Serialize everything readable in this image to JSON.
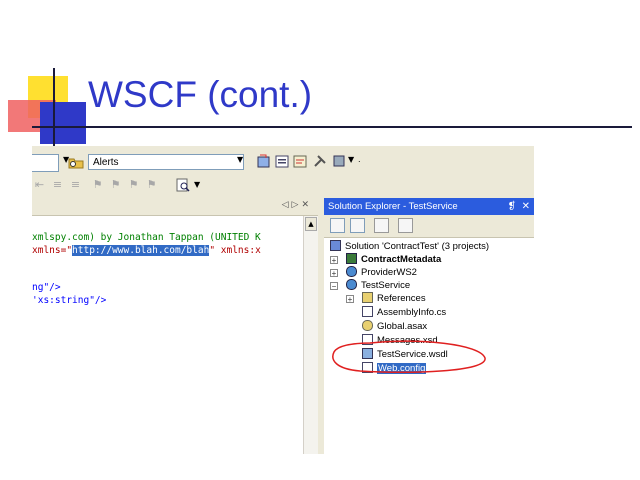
{
  "slide": {
    "title": "WSCF (cont.)"
  },
  "toolbar": {
    "combo_value": "Alerts"
  },
  "editor": {
    "line1_prefix": "xmlspy.com) by Jonathan Tappan (UNITED K",
    "line2_attr": "xmlns=\"",
    "line2_url": "http://www.blah.com/blah",
    "line2_tail": "\" xmlns:x",
    "line3": "ng\"/>",
    "line4": "'xs:string\"/>"
  },
  "solution_explorer": {
    "title": "Solution Explorer - TestService",
    "pin_glyph": "❡",
    "close_glyph": "✕",
    "items": [
      {
        "label": "Solution 'ContractTest' (3 projects)"
      },
      {
        "label": "ContractMetadata"
      },
      {
        "label": "ProviderWS2"
      },
      {
        "label": "TestService"
      },
      {
        "label": "References"
      },
      {
        "label": "AssemblyInfo.cs"
      },
      {
        "label": "Global.asax"
      },
      {
        "label": "Messages.xsd"
      },
      {
        "label": "TestService.wsdl"
      },
      {
        "label": "Web.config"
      }
    ]
  },
  "colors": {
    "title_blue": "#2f39c8",
    "selection": "#316ac5",
    "annotation_red": "#e02020"
  }
}
